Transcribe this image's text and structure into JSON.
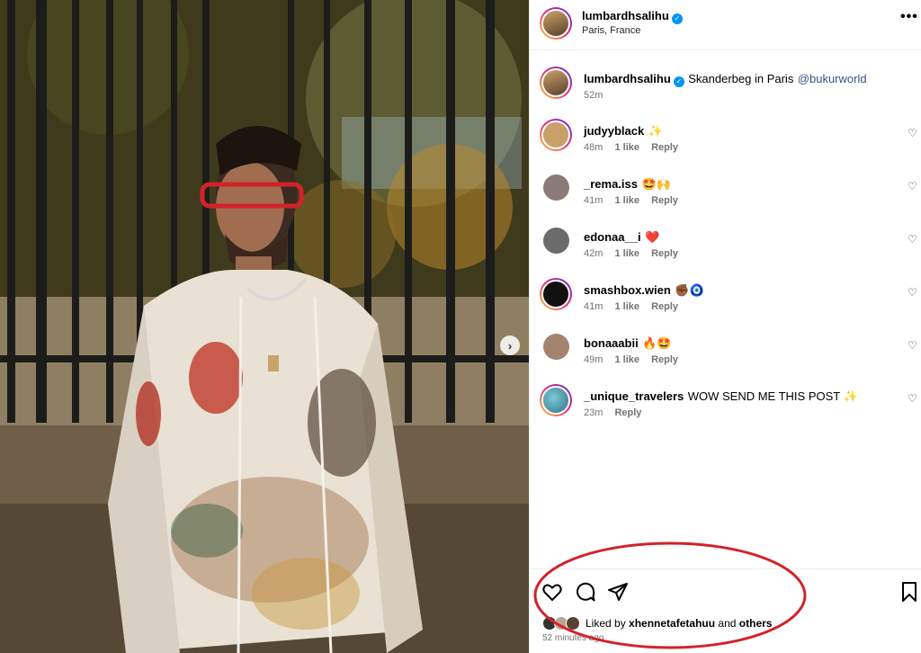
{
  "post": {
    "username": "lumbardhsalihu",
    "location": "Paris, France",
    "caption": "Skanderbeg in Paris",
    "caption_mention": "@bukurworld",
    "caption_time": "52m",
    "more_label": "•••",
    "next_label": "›"
  },
  "comments": [
    {
      "user": "judyyblack",
      "text": "✨",
      "time": "48m",
      "likes": "1 like",
      "reply": "Reply",
      "avatar_color": "#c9a06a"
    },
    {
      "user": "_rema.iss",
      "text": "🤩🙌",
      "time": "41m",
      "likes": "1 like",
      "reply": "Reply",
      "avatar_color": "#8a7b77"
    },
    {
      "user": "edonaa__i",
      "text": "❤️",
      "time": "42m",
      "likes": "1 like",
      "reply": "Reply",
      "avatar_color": "#6b6b6b"
    },
    {
      "user": "smashbox.wien",
      "text": "✊🏾🧿",
      "time": "41m",
      "likes": "1 like",
      "reply": "Reply",
      "avatar_color": "#111111"
    },
    {
      "user": "bonaaabii",
      "text": "🔥🤩",
      "time": "49m",
      "likes": "1 like",
      "reply": "Reply",
      "avatar_color": "#a48470"
    },
    {
      "user": "_unique_travelers",
      "text": "WOW SEND ME THIS POST ✨",
      "time": "23m",
      "likes": "",
      "reply": "Reply",
      "avatar_color": "#3f8fa3"
    }
  ],
  "footer": {
    "liked_prefix": "Liked by",
    "liked_user": "xhennetafetahuu",
    "liked_and": "and",
    "liked_others": "others",
    "timestamp": "52 minutes ago"
  },
  "icons": {
    "like": "heart-icon",
    "comment": "comment-icon",
    "share": "share-icon",
    "save": "bookmark-icon",
    "more": "more-options-icon",
    "verified": "verified-badge-icon",
    "next": "chevron-right-icon"
  },
  "colors": {
    "verified": "#0095f6",
    "annotation": "#d3222a",
    "mention": "#385185"
  }
}
